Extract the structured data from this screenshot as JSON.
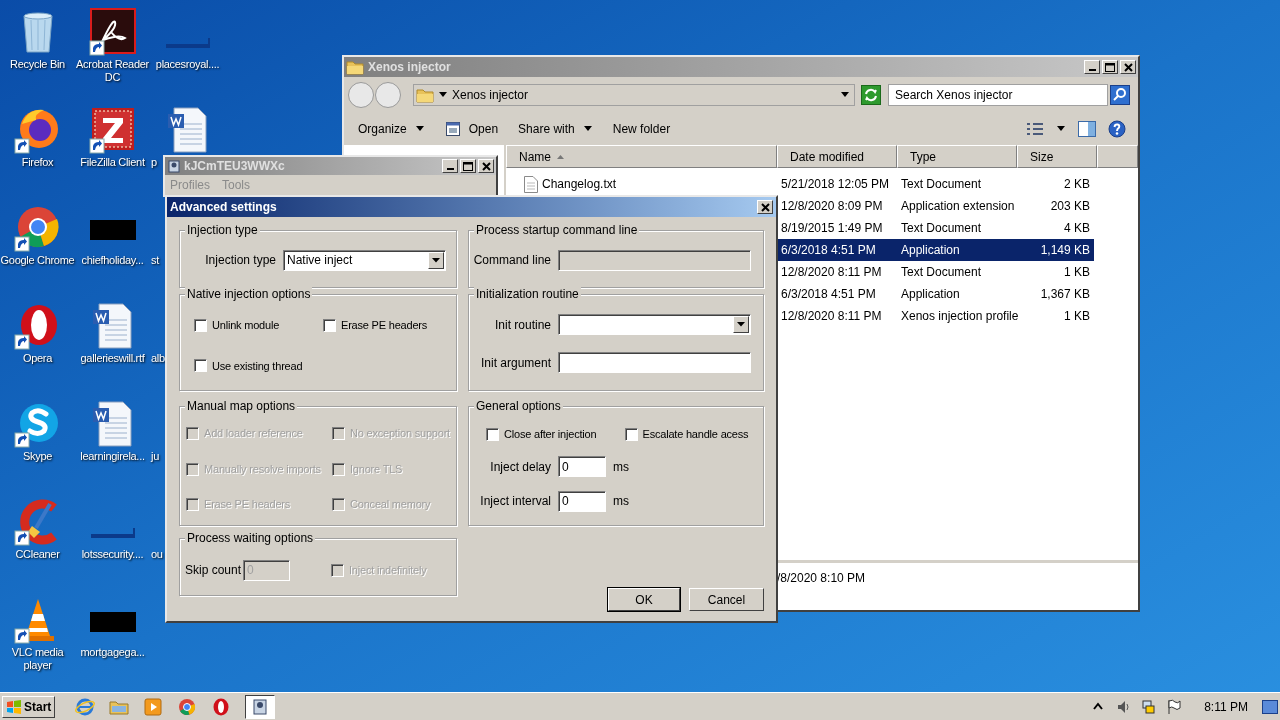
{
  "desktop": {
    "icon_rows": [
      [
        {
          "label": "Recycle Bin",
          "kind": "recycle",
          "shortcut": false,
          "cut": false
        },
        {
          "label": "Acrobat Reader DC",
          "kind": "acrobat",
          "shortcut": true,
          "cut": false
        },
        {
          "label": "placesroyal....",
          "kind": "dark_file",
          "shortcut": false,
          "cut": false
        }
      ],
      [
        {
          "label": "Firefox",
          "kind": "firefox",
          "shortcut": true,
          "cut": false
        },
        {
          "label": "FileZilla Client",
          "kind": "filezilla",
          "shortcut": true,
          "cut": false
        },
        {
          "label": "p",
          "kind": "word",
          "shortcut": false,
          "cut": true
        }
      ],
      [
        {
          "label": "Google Chrome",
          "kind": "chrome",
          "shortcut": true,
          "cut": false
        },
        {
          "label": "chiefholiday...",
          "kind": "black",
          "shortcut": false,
          "cut": false
        },
        {
          "label": "st",
          "kind": "none",
          "cut": true
        }
      ],
      [
        {
          "label": "Opera",
          "kind": "opera",
          "shortcut": true,
          "cut": false
        },
        {
          "label": "gallerieswill.rtf",
          "kind": "word",
          "shortcut": false,
          "cut": false
        },
        {
          "label": "alb",
          "kind": "none",
          "cut": true
        }
      ],
      [
        {
          "label": "Skype",
          "kind": "skype",
          "shortcut": true,
          "cut": false
        },
        {
          "label": "learningirela...",
          "kind": "word",
          "shortcut": false,
          "cut": false
        },
        {
          "label": "ju",
          "kind": "none",
          "cut": true
        }
      ],
      [
        {
          "label": "CCleaner",
          "kind": "ccleaner",
          "shortcut": true,
          "cut": false
        },
        {
          "label": "lotssecurity....",
          "kind": "dark_file",
          "shortcut": false,
          "cut": false
        },
        {
          "label": "ou",
          "kind": "none",
          "cut": true
        }
      ],
      [
        {
          "label": "VLC media player",
          "kind": "vlc",
          "shortcut": true,
          "cut": false
        },
        {
          "label": "mortgagega...",
          "kind": "black",
          "shortcut": false,
          "cut": false
        }
      ]
    ]
  },
  "explorer": {
    "title": "Xenos injector",
    "address": "Xenos injector",
    "search_placeholder": "Search Xenos injector",
    "toolbar": [
      {
        "label": "Organize",
        "kind": "menu"
      },
      {
        "label": "Open",
        "kind": "open"
      },
      {
        "label": "Share with",
        "kind": "menu"
      },
      {
        "label": "New folder",
        "kind": "plain"
      }
    ],
    "columns": [
      "Name",
      "Date modified",
      "Type",
      "Size"
    ],
    "rows": [
      {
        "name": "Changelog.txt",
        "date": "5/21/2018 12:05 PM",
        "type": "Text Document",
        "size": "2 KB",
        "selected": false
      },
      {
        "date": "12/8/2020 8:09 PM",
        "type": "Application extension",
        "size": "203 KB",
        "selected": false
      },
      {
        "date": "8/19/2015 1:49 PM",
        "type": "Text Document",
        "size": "4 KB",
        "selected": false
      },
      {
        "date": "6/3/2018 4:51 PM",
        "type": "Application",
        "size": "1,149 KB",
        "selected": true
      },
      {
        "date": "12/8/2020 8:11 PM",
        "type": "Text Document",
        "size": "1 KB",
        "selected": false
      },
      {
        "date": "6/3/2018 4:51 PM",
        "type": "Application",
        "size": "1,367 KB",
        "selected": false
      },
      {
        "date": "12/8/2020 8:11 PM",
        "type": "Xenos injection profile",
        "size": "1 KB",
        "selected": false
      }
    ],
    "details": "/8/2020 8:10 PM"
  },
  "app_window": {
    "title": "kJCmTEU3WWXc",
    "menu": [
      {
        "label": "Profiles",
        "disabled": true
      },
      {
        "label": "Tools",
        "disabled": true
      }
    ]
  },
  "dialog": {
    "title": "Advanced settings",
    "left_groups": [
      {
        "title": "Injection type",
        "kind": "form",
        "items": [
          {
            "kind": "combo",
            "label": "Injection type",
            "value": "Native inject",
            "disabled": false
          }
        ]
      },
      {
        "title": "Native injection options",
        "kind": "checks",
        "items": [
          {
            "kind": "checkbox",
            "label": "Unlink module",
            "checked": false,
            "disabled": false
          },
          {
            "kind": "checkbox",
            "label": "Erase PE headers",
            "checked": false,
            "disabled": false
          },
          {
            "kind": "checkbox",
            "label": "Use existing thread",
            "checked": false,
            "disabled": false
          }
        ]
      },
      {
        "title": "Manual map options",
        "kind": "checks",
        "items": [
          {
            "kind": "checkbox",
            "label": "Add loader reference",
            "checked": false,
            "disabled": true
          },
          {
            "kind": "checkbox",
            "label": "No exception support",
            "checked": false,
            "disabled": true
          },
          {
            "kind": "checkbox",
            "label": "Manually resolve imports",
            "checked": false,
            "disabled": true
          },
          {
            "kind": "checkbox",
            "label": "Ignore TLS",
            "checked": false,
            "disabled": true
          },
          {
            "kind": "checkbox",
            "label": "Erase PE headers",
            "checked": false,
            "disabled": true
          },
          {
            "kind": "checkbox",
            "label": "Conceal memory",
            "checked": false,
            "disabled": true
          }
        ]
      },
      {
        "title": "Process waiting options",
        "kind": "inline",
        "items": [
          {
            "kind": "field",
            "label": "Skip count",
            "value": "0",
            "disabled": true
          },
          {
            "kind": "checkbox",
            "label": "Inject indefinitely",
            "checked": false,
            "disabled": true
          }
        ]
      }
    ],
    "right_groups": [
      {
        "title": "Process startup command line",
        "kind": "form",
        "items": [
          {
            "kind": "field",
            "label": "Command line",
            "disabled": true
          }
        ]
      },
      {
        "title": "Initialization routine",
        "kind": "form",
        "items": [
          {
            "kind": "combo",
            "label": "Init routine",
            "disabled": false
          },
          {
            "kind": "field",
            "label": "Init argument",
            "disabled": false
          }
        ]
      },
      {
        "title": "General options",
        "kind": "checks_form",
        "items": [
          {
            "kind": "checkbox",
            "label": "Close after injection",
            "checked": false,
            "disabled": false
          },
          {
            "kind": "checkbox",
            "label": "Escalate handle acess",
            "checked": false,
            "disabled": false
          },
          {
            "kind": "field",
            "label": "Inject delay",
            "value": "0",
            "unit": "ms",
            "disabled": false
          },
          {
            "kind": "field",
            "label": "Inject interval",
            "value": "0",
            "unit": "ms",
            "disabled": false
          }
        ]
      }
    ],
    "buttons": [
      {
        "label": "OK",
        "default": true
      },
      {
        "label": "Cancel",
        "default": false
      }
    ]
  },
  "taskbar": {
    "start": "Start",
    "items": [
      {
        "kind": "ie",
        "selected": false
      },
      {
        "kind": "folder",
        "selected": false
      },
      {
        "kind": "media",
        "selected": false
      },
      {
        "kind": "chrome",
        "selected": false
      },
      {
        "kind": "opera",
        "selected": false
      },
      {
        "kind": "app",
        "selected": true
      }
    ],
    "tray": [
      {
        "kind": "chevron"
      },
      {
        "kind": "speaker"
      },
      {
        "kind": "network"
      },
      {
        "kind": "flag"
      }
    ],
    "clock": "8:11 PM"
  }
}
